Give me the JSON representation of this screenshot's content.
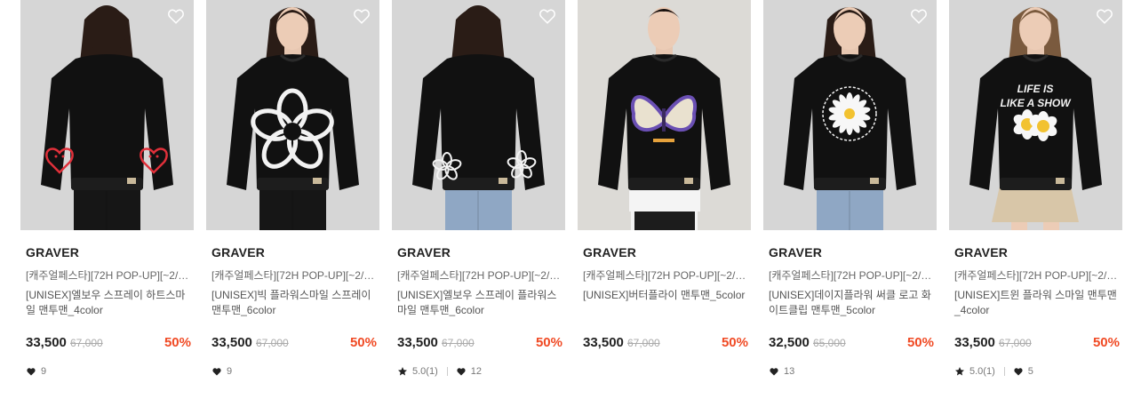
{
  "products": [
    {
      "brand": "GRAVER",
      "tag": "[캐주얼페스타][72H POP-UP][~2/13...",
      "name": "[UNISEX]엘보우 스프레이 하트스마일 맨투맨_4color",
      "price": "33,500",
      "original_price": "67,000",
      "discount": "50%",
      "rating": "",
      "likes": "9",
      "view": "back",
      "graphic": "heart-sleeves",
      "bottom": "black",
      "hair": "#2a1c16"
    },
    {
      "brand": "GRAVER",
      "tag": "[캐주얼페스타][72H POP-UP][~2/13...",
      "name": "[UNISEX]빅 플라워스마일 스프레이 맨투맨_6color",
      "price": "33,500",
      "original_price": "67,000",
      "discount": "50%",
      "rating": "",
      "likes": "9",
      "view": "front",
      "graphic": "big-flower",
      "bottom": "black",
      "hair": "#2a1c16"
    },
    {
      "brand": "GRAVER",
      "tag": "[캐주얼페스타][72H POP-UP][~2/13...",
      "name": "[UNISEX]엘보우 스프레이 플라워스마일 맨투맨_6color",
      "price": "33,500",
      "original_price": "67,000",
      "discount": "50%",
      "rating": "5.0(1)",
      "likes": "12",
      "view": "back",
      "graphic": "flower-sleeves",
      "bottom": "jeans",
      "hair": "#2a1c16"
    },
    {
      "brand": "GRAVER",
      "tag": "[캐주얼페스타][72H POP-UP][~2/13...",
      "name": "[UNISEX]버터플라이 맨투맨_5color",
      "price": "33,500",
      "original_price": "67,000",
      "discount": "50%",
      "rating": "",
      "likes": "",
      "view": "front-male",
      "graphic": "butterfly",
      "bottom": "white",
      "hair": "#1a1210"
    },
    {
      "brand": "GRAVER",
      "tag": "[캐주얼페스타][72H POP-UP][~2/13...",
      "name": "[UNISEX]데이지플라워 써클 로고 화이트클립 맨투맨_5color",
      "price": "32,500",
      "original_price": "65,000",
      "discount": "50%",
      "rating": "",
      "likes": "13",
      "view": "front",
      "graphic": "daisy-circle",
      "bottom": "jeans",
      "hair": "#2a1c16"
    },
    {
      "brand": "GRAVER",
      "tag": "[캐주얼페스타][72H POP-UP][~2/13...",
      "name": "[UNISEX]트윈 플라워 스마일 맨투맨_4color",
      "price": "33,500",
      "original_price": "67,000",
      "discount": "50%",
      "rating": "5.0(1)",
      "likes": "5",
      "view": "front",
      "graphic": "life-is-like-a-show",
      "bottom": "beige",
      "hair": "#7a5a3e",
      "graphic_text_1": "LIFE IS",
      "graphic_text_2": "LIKE A SHOW"
    }
  ],
  "icons": {
    "wishlist": "heart-outline-icon",
    "like": "heart-icon",
    "rating": "star-icon"
  },
  "colors": {
    "discount": "#f04a24",
    "sweatshirt": "#111111",
    "photo_bg": "#d6d6d6"
  }
}
